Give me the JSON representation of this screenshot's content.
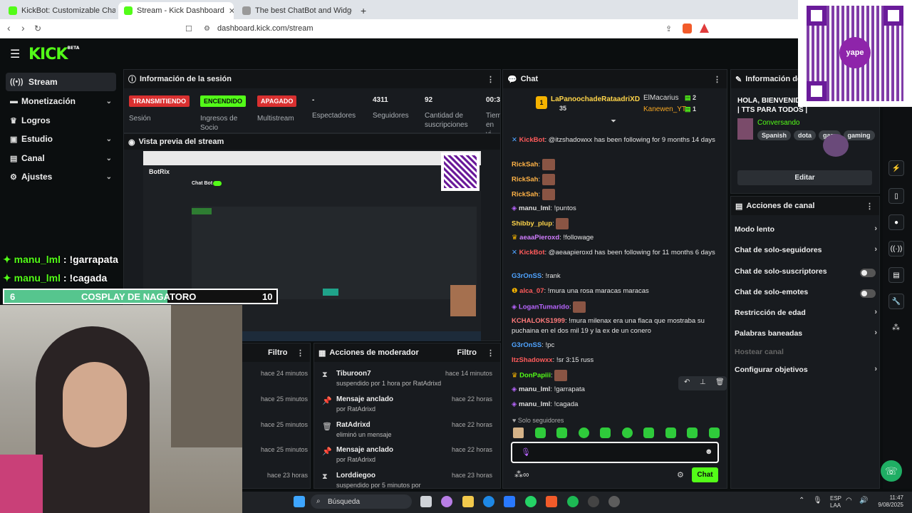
{
  "browser": {
    "tabs": [
      {
        "label": "KickBot: Customizable Chat Bot for K",
        "color": "#53fc18"
      },
      {
        "label": "Stream - Kick Dashboard",
        "color": "#53fc18"
      },
      {
        "label": "The best ChatBot and Widgets for Ki",
        "color": "#888888"
      }
    ],
    "url": "dashboard.kick.com/stream"
  },
  "kick": {
    "logo": "KICK",
    "logo_sup": "BETA",
    "accent": "#53fc18"
  },
  "sidebar": {
    "items": [
      {
        "label": "Stream",
        "icon": "stream-icon"
      },
      {
        "label": "Monetización",
        "icon": "money-icon"
      },
      {
        "label": "Logros",
        "icon": "trophy-icon"
      },
      {
        "label": "Estudio",
        "icon": "studio-icon"
      },
      {
        "label": "Canal",
        "icon": "channel-icon"
      },
      {
        "label": "Ajustes",
        "icon": "gear-icon"
      }
    ]
  },
  "session": {
    "title": "Información de la sesión",
    "stats": [
      {
        "badge": "TRANSMITIENDO",
        "label": "Sesión"
      },
      {
        "badge": "ENCENDIDO",
        "label": "Ingresos de Socio"
      },
      {
        "badge": "APAGADO",
        "label": "Multistream"
      },
      {
        "value": "-",
        "label": "Espectadores"
      },
      {
        "value": "4311",
        "label": "Seguidores"
      },
      {
        "value": "92",
        "label": "Cantidad de suscripciones"
      },
      {
        "value": "00:3",
        "label": "Tiem en vi"
      }
    ]
  },
  "preview": {
    "title": "Vista previa del stream",
    "inner_app": "BotRix",
    "inner_section": "Chat Bot"
  },
  "overlay": {
    "chat1_name": "manu_lml",
    "chat1_msg": "!garrapata",
    "chat2_name": "manu_lml",
    "chat2_msg": "!cagada",
    "bar_left": "6",
    "bar_title": "COSPLAY DE NAGATORO",
    "bar_right": "10"
  },
  "log_panel": {
    "filter": "Filtro",
    "times": [
      "hace 24 minutos",
      "hace 25 minutos",
      "hace 25 minutos",
      "hace 25 minutos",
      "hace 23 horas"
    ]
  },
  "mod_actions": {
    "title": "Acciones de moderador",
    "filter": "Filtro",
    "rows": [
      {
        "title": "Tiburoon7",
        "sub": "suspendido por 1 hora por RatAdrixd",
        "time": "hace 14 minutos",
        "icon": "hourglass-icon"
      },
      {
        "title": "Mensaje anclado",
        "sub": "por RatAdrixd",
        "time": "hace 22 horas",
        "icon": "pin-icon"
      },
      {
        "title": "RatAdrixd",
        "sub": "eliminó un mensaje",
        "time": "hace 22 horas",
        "icon": "trash-icon"
      },
      {
        "title": "Mensaje anclado",
        "sub": "por RatAdrixd",
        "time": "hace 22 horas",
        "icon": "pin-icon"
      },
      {
        "title": "Lorddiegoo",
        "sub": "suspendido por 5 minutos por",
        "time": "hace 23 horas",
        "icon": "hourglass-icon"
      }
    ]
  },
  "chat": {
    "title": "Chat",
    "top": [
      {
        "name": "LaPanoochadeRataadriXD",
        "count": "35"
      },
      {
        "name": "ElMacarius",
        "count": "2"
      },
      {
        "name": "Kanewen_YT",
        "count": "1"
      }
    ],
    "messages": [
      {
        "name": "KickBot",
        "color": "#ff5b5b",
        "text": ": @itzshadowxx has been following for 9 months 14 days"
      },
      {
        "name": "RickSah",
        "color": "#ffb347",
        "text": ":"
      },
      {
        "name": "RickSah",
        "color": "#ffb347",
        "text": ":"
      },
      {
        "name": "RickSah",
        "color": "#ffb347",
        "text": ":"
      },
      {
        "name": "manu_lml",
        "color": "#dddddd",
        "text": ": !puntos"
      },
      {
        "name": "Shibby_plup",
        "color": "#ffd54a",
        "text": ":"
      },
      {
        "name": "aeaaPieroxd",
        "color": "#d17dff",
        "text": ": !followage"
      },
      {
        "name": "KickBot",
        "color": "#ff5b5b",
        "text": ": @aeaapieroxd has been following for 11 months 6 days"
      },
      {
        "name": "G3rOnSS",
        "color": "#4fa3ff",
        "text": ": !rank"
      },
      {
        "name": "alca_07",
        "color": "#ff5b5b",
        "text": ": !mura una rosa maracas maracas"
      },
      {
        "name": "LoganTumarido",
        "color": "#b865ff",
        "text": ":"
      },
      {
        "name": "KCHALOKS1999",
        "color": "#ff7a7a",
        "text": ": !mura milenax era una flaca que mostraba su puchaina en el dos mil 19 y la ex de un conero"
      },
      {
        "name": "G3rOnSS",
        "color": "#4fa3ff",
        "text": ": !pc"
      },
      {
        "name": "ItzShadowxx",
        "color": "#ff5b5b",
        "text": ": !sr 3:15 russ"
      },
      {
        "name": "DonPapiii",
        "color": "#53fc18",
        "text": ":"
      },
      {
        "name": "manu_lml",
        "color": "#dddddd",
        "text": ": !garrapata"
      },
      {
        "name": "manu_lml",
        "color": "#dddddd",
        "text": ": !cagada"
      }
    ],
    "mode": "Solo seguidores",
    "send": "Chat"
  },
  "info": {
    "title": "Información del",
    "heading": "HOLA, BIENVENIDO",
    "heading2": "| TTS PARA TODOS |",
    "category": "Conversando",
    "tags": [
      "Spanish",
      "dota",
      "gam",
      "gaming"
    ],
    "edit": "Editar"
  },
  "channel_actions": {
    "title": "Acciones de canal",
    "items": [
      {
        "label": "Modo lento",
        "type": "chevron"
      },
      {
        "label": "Chat de solo-seguidores",
        "type": "chevron"
      },
      {
        "label": "Chat de solo-suscriptores",
        "type": "toggle"
      },
      {
        "label": "Chat de solo-emotes",
        "type": "toggle"
      },
      {
        "label": "Restricción de edad",
        "type": "chevron"
      },
      {
        "label": "Palabras baneadas",
        "type": "chevron"
      },
      {
        "label": "Hostear canal",
        "type": "disabled"
      },
      {
        "label": "Configurar objetivos",
        "type": "chevron"
      }
    ]
  },
  "qr": {
    "label": "yape"
  },
  "taskbar": {
    "search": "Búsqueda",
    "lang1": "ESP",
    "lang2": "LAA",
    "time": "11:47",
    "date": "9/08/2025"
  }
}
